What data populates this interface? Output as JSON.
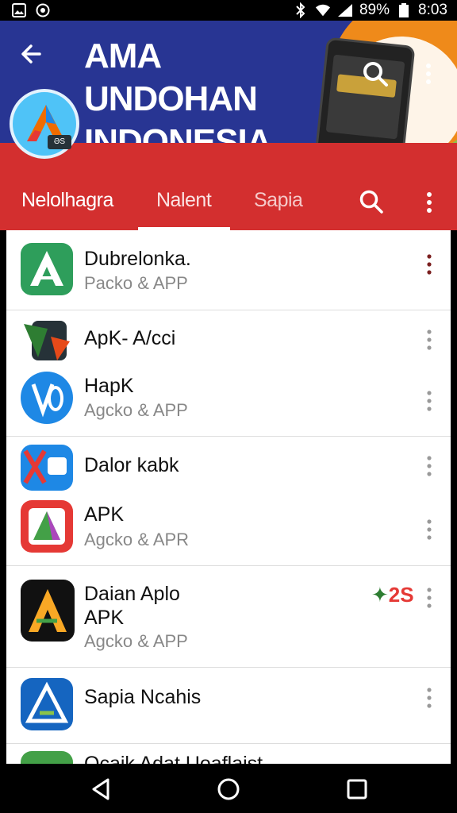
{
  "status_bar": {
    "left_icons": [
      "photo-icon",
      "whatsapp-icon"
    ],
    "right_icons": [
      "bluetooth-icon",
      "wifi-icon",
      "signal-icon",
      "battery-icon"
    ],
    "battery": "89%",
    "time": "8:03"
  },
  "header": {
    "banner_title_line1": "AMA UNDOHAN",
    "banner_title_line2": "INDONESIA",
    "logo_badge": "ƏS"
  },
  "tabs": [
    {
      "label": "Nelolhagra"
    },
    {
      "label": "Nalent"
    },
    {
      "label": "Sapia"
    }
  ],
  "apps": [
    {
      "title": "Dubrelonka.",
      "subtitle": "Packo & APP"
    },
    {
      "title": "ApK- A/cci",
      "subtitle": ""
    },
    {
      "title": "HapK",
      "subtitle": "Agcko & APP"
    },
    {
      "title": "Dalor kabk",
      "subtitle": ""
    },
    {
      "title": "APK",
      "subtitle": "Agcko & APR"
    },
    {
      "title": "Daian Aplo",
      "title2": "APK",
      "subtitle": "Agcko & APP",
      "badge": "2S"
    },
    {
      "title": "Sapia Ncahis",
      "subtitle": ""
    },
    {
      "title": "Ocaik Adat Uoaflaist",
      "subtitle": ""
    }
  ],
  "colors": {
    "banner": "#283593",
    "accent": "#d32f2f",
    "list_bg": "#ffffff"
  }
}
